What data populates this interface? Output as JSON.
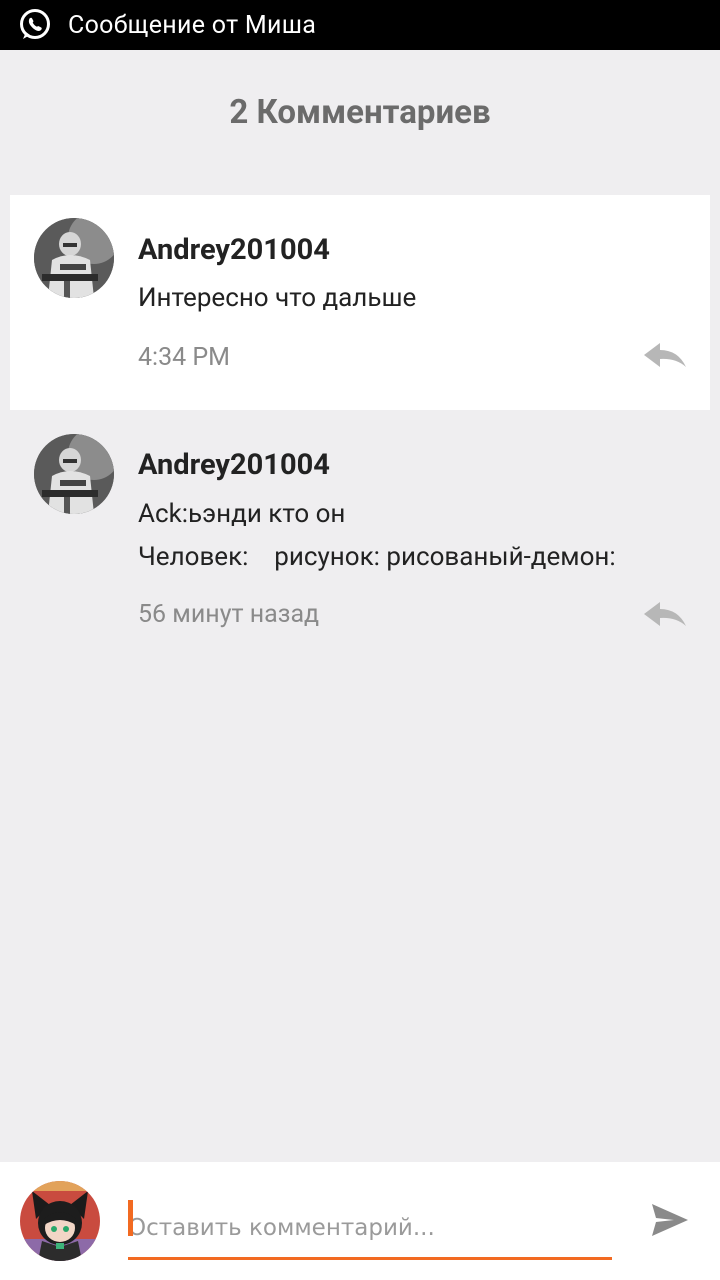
{
  "notification": {
    "icon": "whatsapp-icon",
    "text": "Сообщение от Миша"
  },
  "header": {
    "title": "2 Комментариев"
  },
  "comments": [
    {
      "username": "Andrey201004",
      "lines": [
        "Интересно что дальше"
      ],
      "time": "4:34 PM",
      "avatar_icon": "soldier-avatar"
    },
    {
      "username": "Andrey201004",
      "lines": [
        "Ack:ьэнди кто он",
        "Человек:    рисунок: рисованый-демон:"
      ],
      "time": "56 минут назад",
      "avatar_icon": "soldier-avatar"
    }
  ],
  "composer": {
    "placeholder": "Оставить комментарий...",
    "value": "",
    "send_icon": "send-icon",
    "avatar_icon": "anime-girl-avatar"
  },
  "colors": {
    "accent": "#f26a21",
    "background": "#efeef0",
    "card": "#ffffff",
    "title": "#6b6b6b",
    "muted": "#8a8a8a"
  }
}
